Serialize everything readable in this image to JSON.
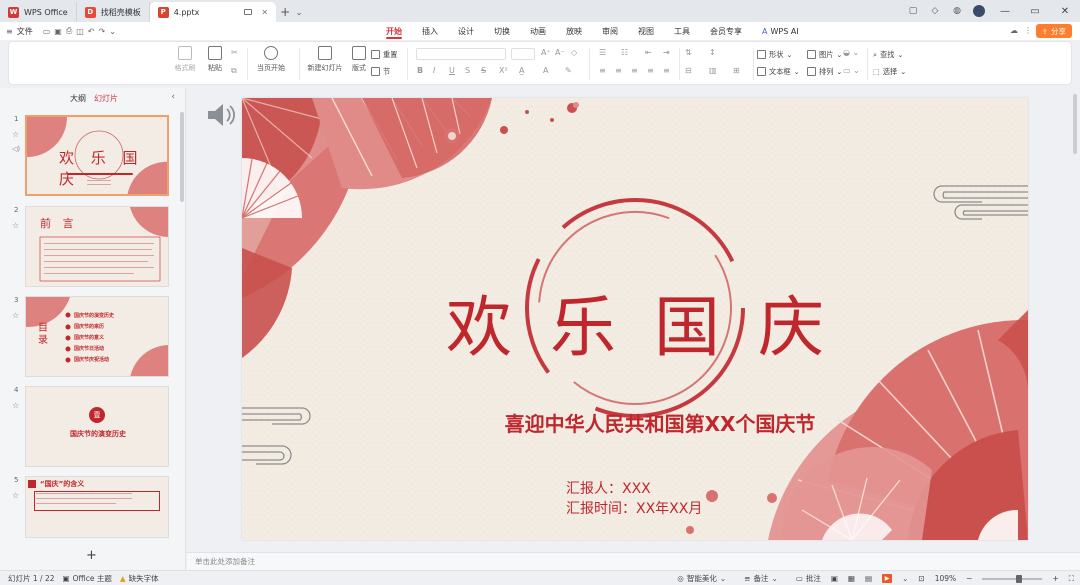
{
  "titlebar": {
    "tabs": [
      {
        "label": "WPS Office",
        "icon": "wps-logo-icon",
        "color": "#d23a3a"
      },
      {
        "label": "找稻壳模板",
        "icon": "docer-icon",
        "color": "#e84a3a"
      },
      {
        "label": "4.pptx",
        "icon": "pptx-file-icon",
        "color": "#d8452f"
      }
    ]
  },
  "menu": {
    "file_label": "文件",
    "tabs": [
      "开始",
      "插入",
      "设计",
      "切换",
      "动画",
      "放映",
      "审阅",
      "视图",
      "工具",
      "会员专享",
      "WPS AI"
    ],
    "active_tab": "开始",
    "share_label": "分享"
  },
  "ribbon": {
    "format_painter": "格式刷",
    "paste": "粘贴",
    "from_current": "当页开始",
    "new_slide": "新建幻灯片",
    "layout": "版式",
    "reset": "重置",
    "section": "节",
    "shape": "形状",
    "picture": "图片",
    "textbox": "文本框",
    "arrange": "排列",
    "find": "查找",
    "select": "选择"
  },
  "left_panel": {
    "outline_tab": "大纲",
    "slides_tab": "幻灯片",
    "thumbnails": [
      {
        "num": "1",
        "title": "欢 乐 国 庆"
      },
      {
        "num": "2",
        "title": "前 言"
      },
      {
        "num": "3",
        "title": "目 录",
        "items": [
          "国庆节的演变历史",
          "国庆节的来历",
          "国庆节的意义",
          "国庆节日活动",
          "国庆节庆祝活动"
        ]
      },
      {
        "num": "4",
        "badge": "壹",
        "title": "国庆节的演变历史"
      },
      {
        "num": "5",
        "title": "“国庆”的含义"
      }
    ]
  },
  "slide": {
    "title": "欢乐国庆",
    "subtitle": "喜迎中华人民共和国第XX个国庆节",
    "reporter": "汇报人：XXX",
    "report_time": "汇报时间：XX年XX月",
    "accent_color": "#c0272d"
  },
  "notes_placeholder": "单击此处添加备注",
  "status": {
    "slide_count": "幻灯片 1 / 22",
    "theme": "Office 主题",
    "missing_font": "缺失字体",
    "smart_beautify": "智能美化",
    "notes": "备注",
    "comments": "批注",
    "zoom": "109%"
  }
}
